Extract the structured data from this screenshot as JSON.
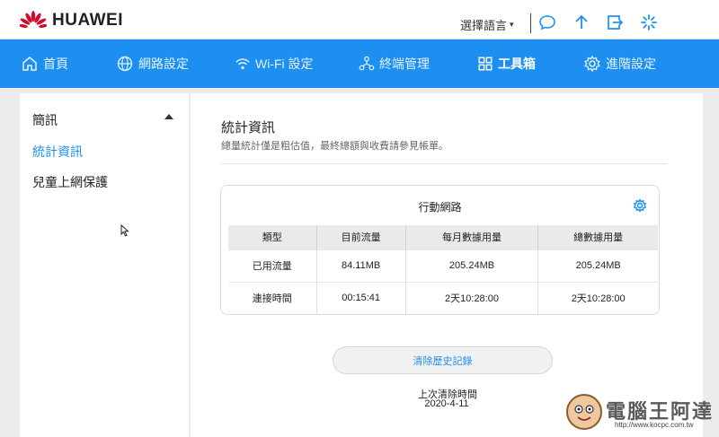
{
  "header": {
    "brand": "HUAWEI",
    "language_label": "選擇語言",
    "brand_color": "#CF0A2C",
    "accent": "#1D8FF1"
  },
  "nav": {
    "items": [
      {
        "label": "首頁",
        "icon": "home-icon"
      },
      {
        "label": "網路設定",
        "icon": "globe-icon"
      },
      {
        "label": "Wi-Fi 設定",
        "icon": "wifi-icon"
      },
      {
        "label": "終端管理",
        "icon": "devices-icon"
      },
      {
        "label": "工具箱",
        "icon": "toolbox-icon",
        "active": true
      },
      {
        "label": "進階設定",
        "icon": "settings-icon"
      }
    ]
  },
  "sidebar": {
    "items": [
      {
        "label": "簡訊"
      },
      {
        "label": "統計資訊",
        "active": true
      },
      {
        "label": "兒童上網保護"
      }
    ]
  },
  "main": {
    "title": "統計資訊",
    "subtitle": "總量統計僅是粗估值，最終總額與收費請參見帳單。",
    "card_title": "行動網路",
    "table": {
      "headers": [
        "類型",
        "目前流量",
        "每月數據用量",
        "總數據用量"
      ],
      "rows": [
        [
          "已用流量",
          "84.11MB",
          "205.24MB",
          "205.24MB"
        ],
        [
          "連接時間",
          "00:15:41",
          "2天10:28:00",
          "2天10:28:00"
        ]
      ]
    },
    "clear_button": "清除歷史記錄",
    "last_cleared_label": "上次清除時間",
    "last_cleared_date": "2020-4-11"
  },
  "watermark": {
    "text": "電腦王阿達",
    "url": "http://www.kocpc.com.tw"
  }
}
